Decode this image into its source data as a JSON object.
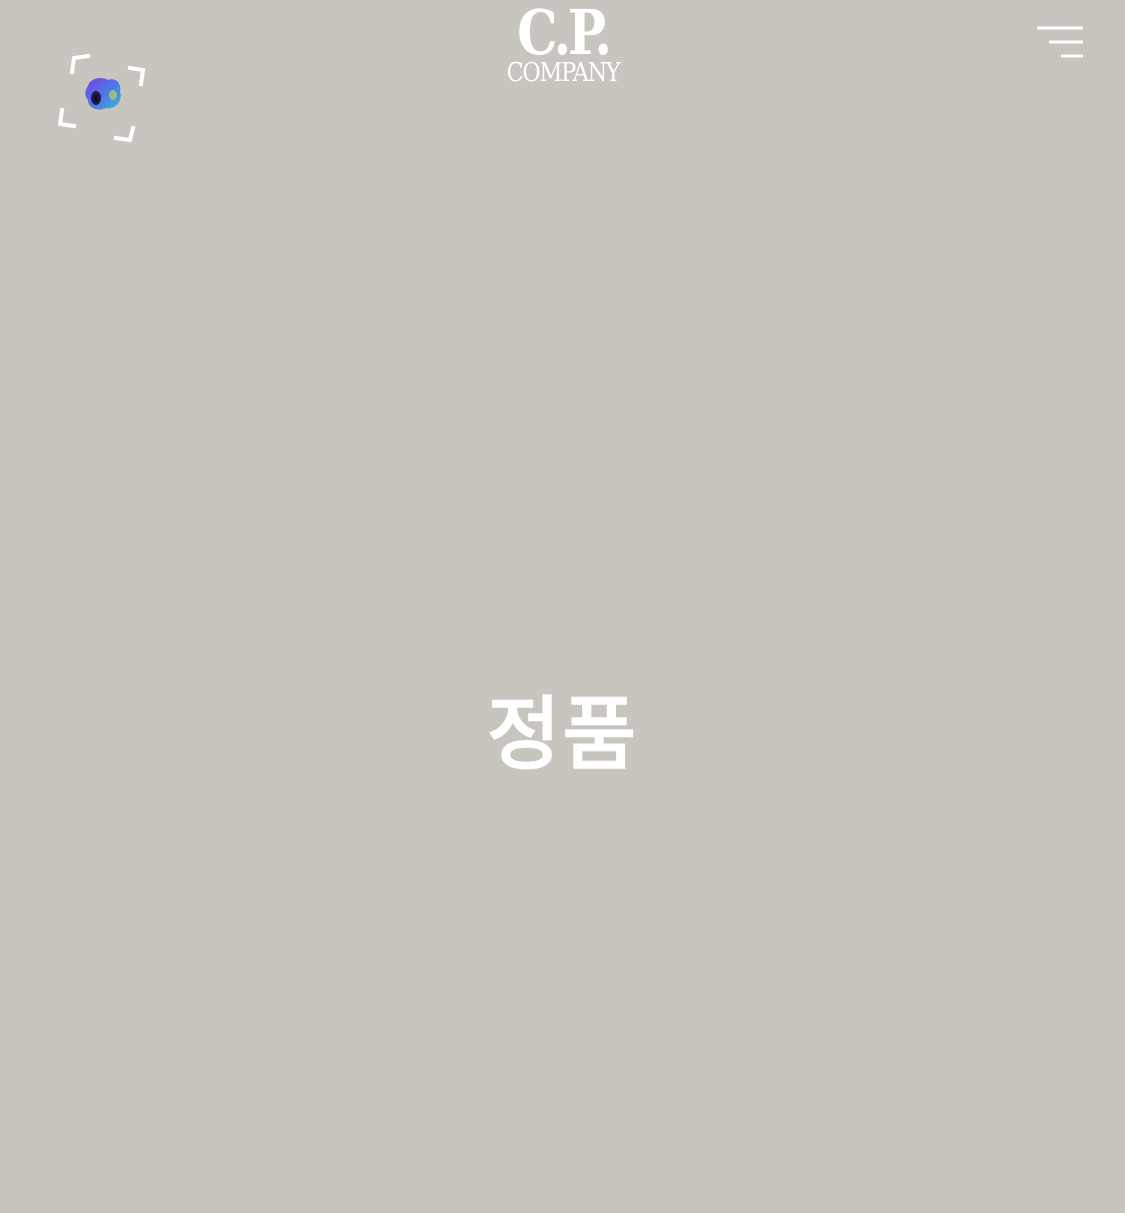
{
  "header": {
    "logo": {
      "line1": "C.P.",
      "line2": "COMPANY"
    },
    "scan_icon": "scan-viewfinder-icon",
    "menu_icon": "hamburger-menu-icon"
  },
  "main": {
    "headline": "정품"
  },
  "colors": {
    "background": "#c8c5be",
    "foreground": "#ffffff"
  }
}
